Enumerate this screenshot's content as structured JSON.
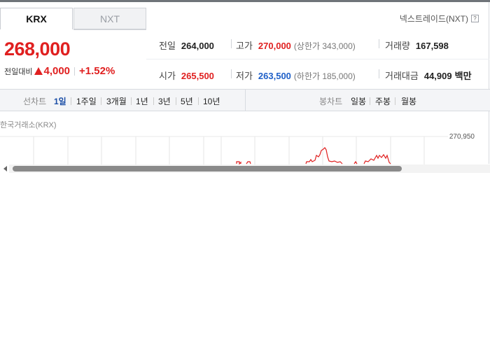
{
  "market_tabs": {
    "active": "KRX",
    "inactive": "NXT"
  },
  "nxt_link": {
    "label": "넥스트레이드(NXT)",
    "help": "?"
  },
  "quote": {
    "price": "268,000",
    "change_label": "전일대비",
    "change_amount": "4,000",
    "change_percent": "+1.52%",
    "direction": "up",
    "up_color": "#e02020",
    "down_color": "#1e5fc8"
  },
  "stats": {
    "prev_close": {
      "label": "전일",
      "value": "264,000"
    },
    "high": {
      "label": "고가",
      "value": "270,000",
      "sub": "(상한가 343,000)"
    },
    "volume": {
      "label": "거래량",
      "value": "167,598"
    },
    "open": {
      "label": "시가",
      "value": "265,500"
    },
    "low": {
      "label": "저가",
      "value": "263,500",
      "sub": "(하한가 185,000)"
    },
    "trade_value": {
      "label": "거래대금",
      "value": "44,909",
      "unit": "백만"
    }
  },
  "chart_tabs": {
    "line_label": "선차트",
    "line_periods": [
      "1일",
      "1주일",
      "3개월",
      "1년",
      "3년",
      "5년",
      "10년"
    ],
    "active_period": "1일",
    "candle_label": "봉차트",
    "candle_periods": [
      "일봉",
      "주봉",
      "월봉"
    ]
  },
  "chart": {
    "exchange": "한국거래소(KRX)",
    "top_tick": "270,950",
    "line_color": "#e02020"
  }
}
